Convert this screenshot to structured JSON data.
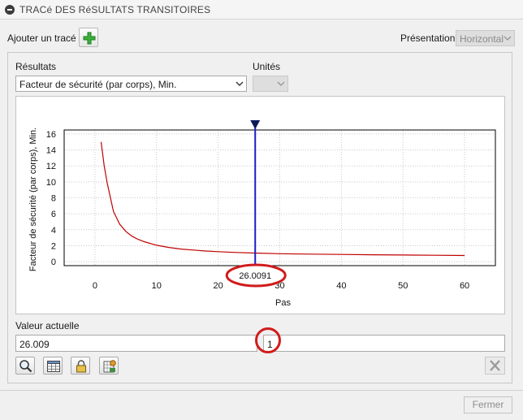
{
  "window": {
    "title": "TRACé DES RéSULTATS TRANSITOIRES"
  },
  "toolbar": {
    "add_trace_label": "Ajouter un tracé",
    "presentation_label": "Présentation",
    "presentation_value": "Horizontal"
  },
  "results": {
    "label": "Résultats",
    "selected": "Facteur de sécurité (par corps), Min.",
    "units_label": "Unités",
    "units_value": ""
  },
  "chart_data": {
    "type": "line",
    "ylabel": "Facteur de sécurité (par corps), Min.",
    "xlabel": "Pas",
    "xlim": [
      -5,
      65
    ],
    "ylim": [
      -0.5,
      16.5
    ],
    "x_ticks": [
      0,
      10,
      20,
      30,
      40,
      50,
      60
    ],
    "y_ticks": [
      0,
      2,
      4,
      6,
      8,
      10,
      12,
      14,
      16
    ],
    "grid": true,
    "series": [
      {
        "color": "#c00000",
        "x": [
          1,
          1.5,
          2,
          3,
          4,
          5,
          6,
          7,
          8,
          10,
          12,
          14,
          16,
          18,
          20,
          23,
          26,
          30,
          35,
          40,
          45,
          50,
          55,
          60
        ],
        "values": [
          15.0,
          12.0,
          9.8,
          6.3,
          4.7,
          3.8,
          3.2,
          2.8,
          2.5,
          2.05,
          1.78,
          1.58,
          1.45,
          1.33,
          1.25,
          1.15,
          1.08,
          1.0,
          0.95,
          0.9,
          0.86,
          0.83,
          0.8,
          0.77
        ]
      }
    ],
    "marker": {
      "x": 26.0091,
      "label": "26.0091",
      "color": "#1c1cc8"
    }
  },
  "current_value": {
    "label": "Valeur actuelle",
    "value": "26.009",
    "step": "1"
  },
  "footer": {
    "close_label": "Fermer"
  }
}
